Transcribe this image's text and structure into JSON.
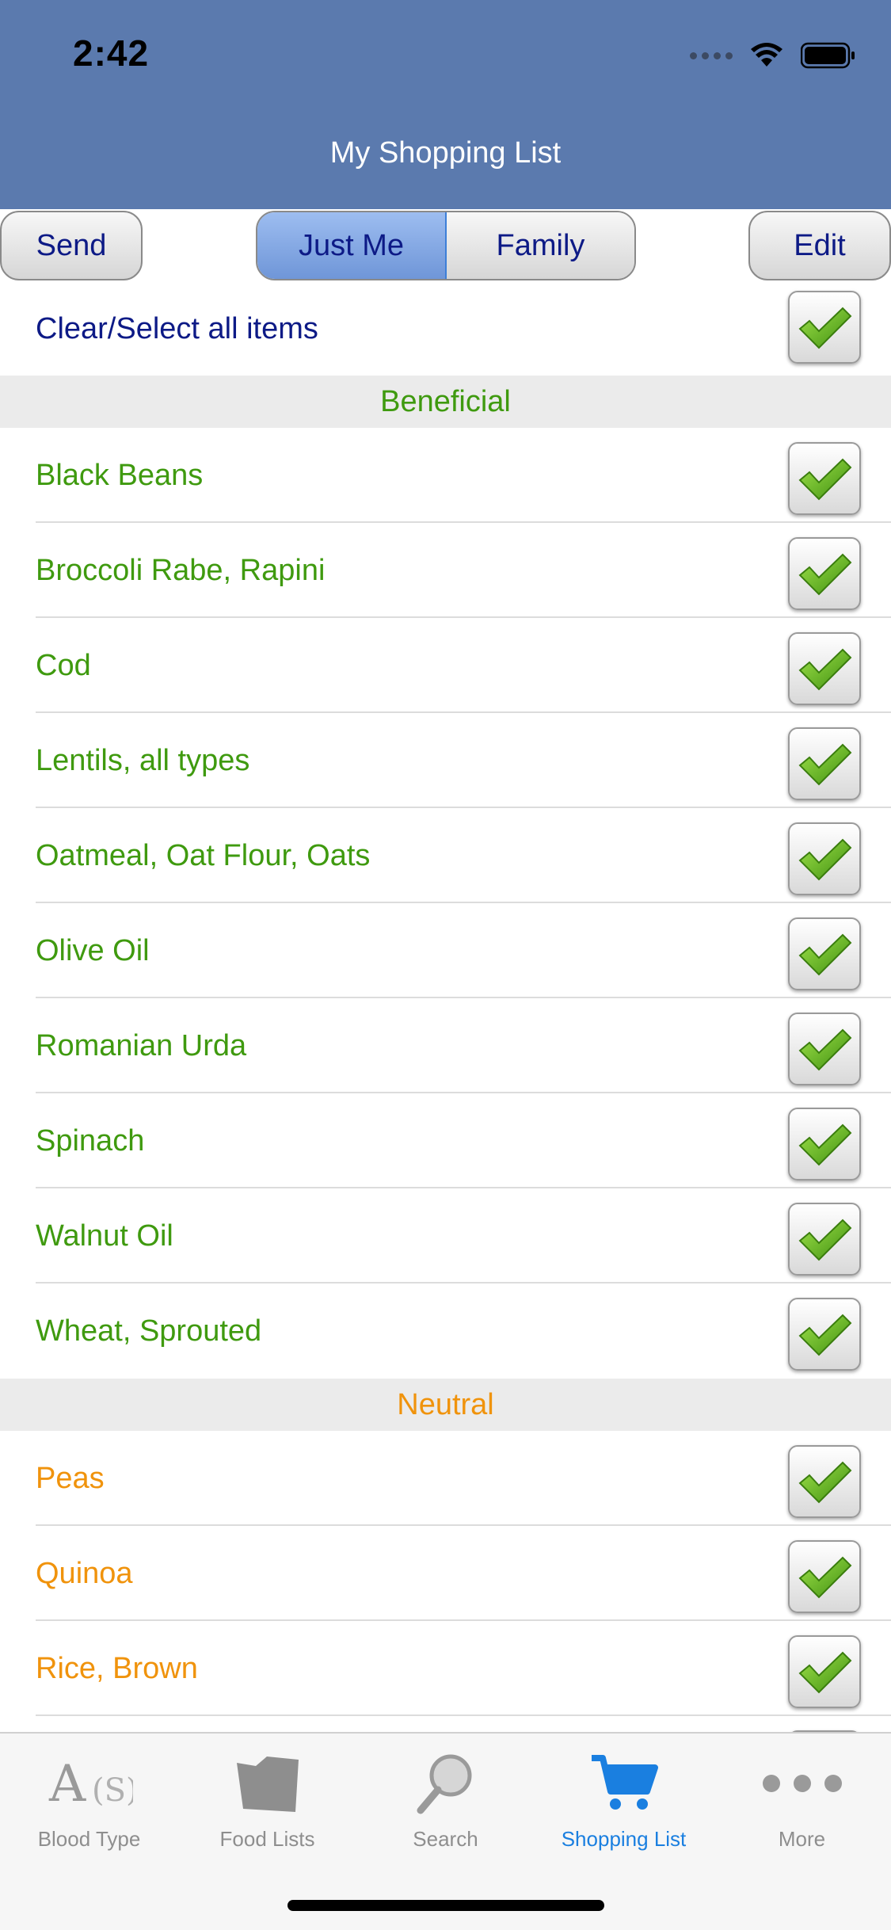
{
  "status_bar": {
    "time": "2:42"
  },
  "nav": {
    "title": "My Shopping List"
  },
  "toolbar": {
    "send_label": "Send",
    "edit_label": "Edit",
    "segments": [
      "Just Me",
      "Family"
    ],
    "selected_segment": "Just Me"
  },
  "list": {
    "clear_select_label": "Clear/Select all items",
    "sections": [
      {
        "title": "Beneficial",
        "color": "#3f9a0f",
        "items": [
          "Black Beans",
          "Broccoli Rabe, Rapini",
          "Cod",
          "Lentils, all types",
          "Oatmeal, Oat Flour, Oats",
          "Olive Oil",
          "Romanian Urda",
          "Spinach",
          "Walnut Oil",
          "Wheat, Sprouted"
        ]
      },
      {
        "title": "Neutral",
        "color": "#f0930c",
        "items": [
          "Peas",
          "Quinoa",
          "Rice, Brown"
        ]
      }
    ]
  },
  "tabbar": {
    "items": [
      {
        "label": "Blood Type",
        "icon": "blood-type-icon"
      },
      {
        "label": "Food Lists",
        "icon": "food-lists-icon"
      },
      {
        "label": "Search",
        "icon": "search-icon"
      },
      {
        "label": "Shopping List",
        "icon": "shopping-cart-icon",
        "active": true
      },
      {
        "label": "More",
        "icon": "more-icon"
      }
    ]
  },
  "colors": {
    "header": "#5b7aae",
    "accent": "#1a7fe0",
    "beneficial": "#3f9a0f",
    "neutral": "#f0930c",
    "link": "#0d1a86"
  }
}
